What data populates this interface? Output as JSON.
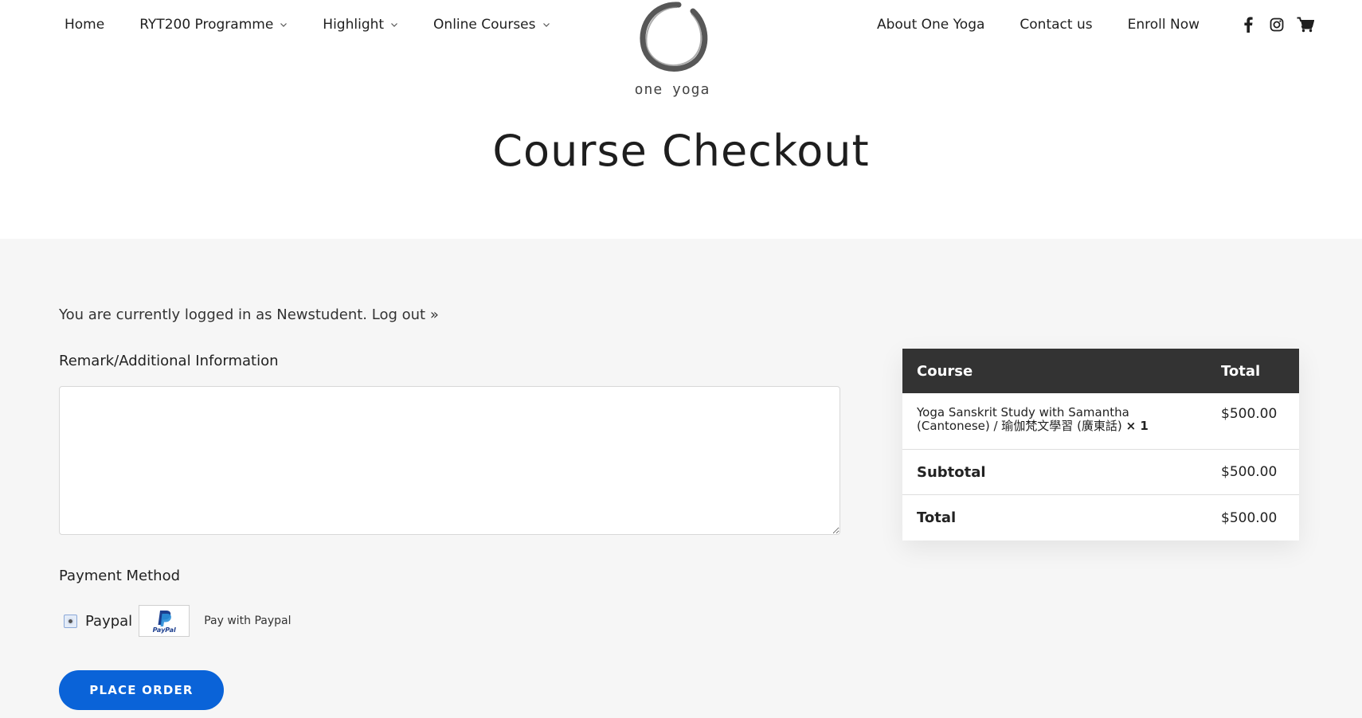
{
  "nav": {
    "left": [
      {
        "label": "Home",
        "dropdown": false
      },
      {
        "label": "RYT200 Programme",
        "dropdown": true
      },
      {
        "label": "Highlight",
        "dropdown": true
      },
      {
        "label": "Online Courses",
        "dropdown": true
      }
    ],
    "right": [
      {
        "label": "About One Yoga"
      },
      {
        "label": "Contact us"
      },
      {
        "label": "Enroll Now"
      }
    ],
    "social_icons": [
      "facebook-icon",
      "instagram-icon",
      "cart-icon"
    ]
  },
  "logo": {
    "text": "one yoga"
  },
  "page": {
    "title": "Course Checkout"
  },
  "account": {
    "logged_in_text": "You are currently logged in as Newstudent.",
    "logout_label": "Log out »"
  },
  "remark": {
    "label": "Remark/Additional Information",
    "value": ""
  },
  "payment": {
    "label": "Payment Method",
    "option_label": "Paypal",
    "option_selected": true,
    "logo_text": "PayPal",
    "description": "Pay with Paypal"
  },
  "actions": {
    "place_order_label": "PLACE ORDER"
  },
  "order": {
    "headers": {
      "course": "Course",
      "total": "Total"
    },
    "item": {
      "name_line1": "Yoga Sanskrit Study with Samantha",
      "name_line2": "(Cantonese) / 瑜伽梵文學習 (廣東話)",
      "qty": "× 1",
      "price": "$500.00"
    },
    "subtotal": {
      "label": "Subtotal",
      "value": "$500.00"
    },
    "total": {
      "label": "Total",
      "value": "$500.00"
    }
  },
  "colors": {
    "accent": "#0a63d8",
    "table_header": "#333333",
    "section_bg": "#f6f6f6"
  }
}
